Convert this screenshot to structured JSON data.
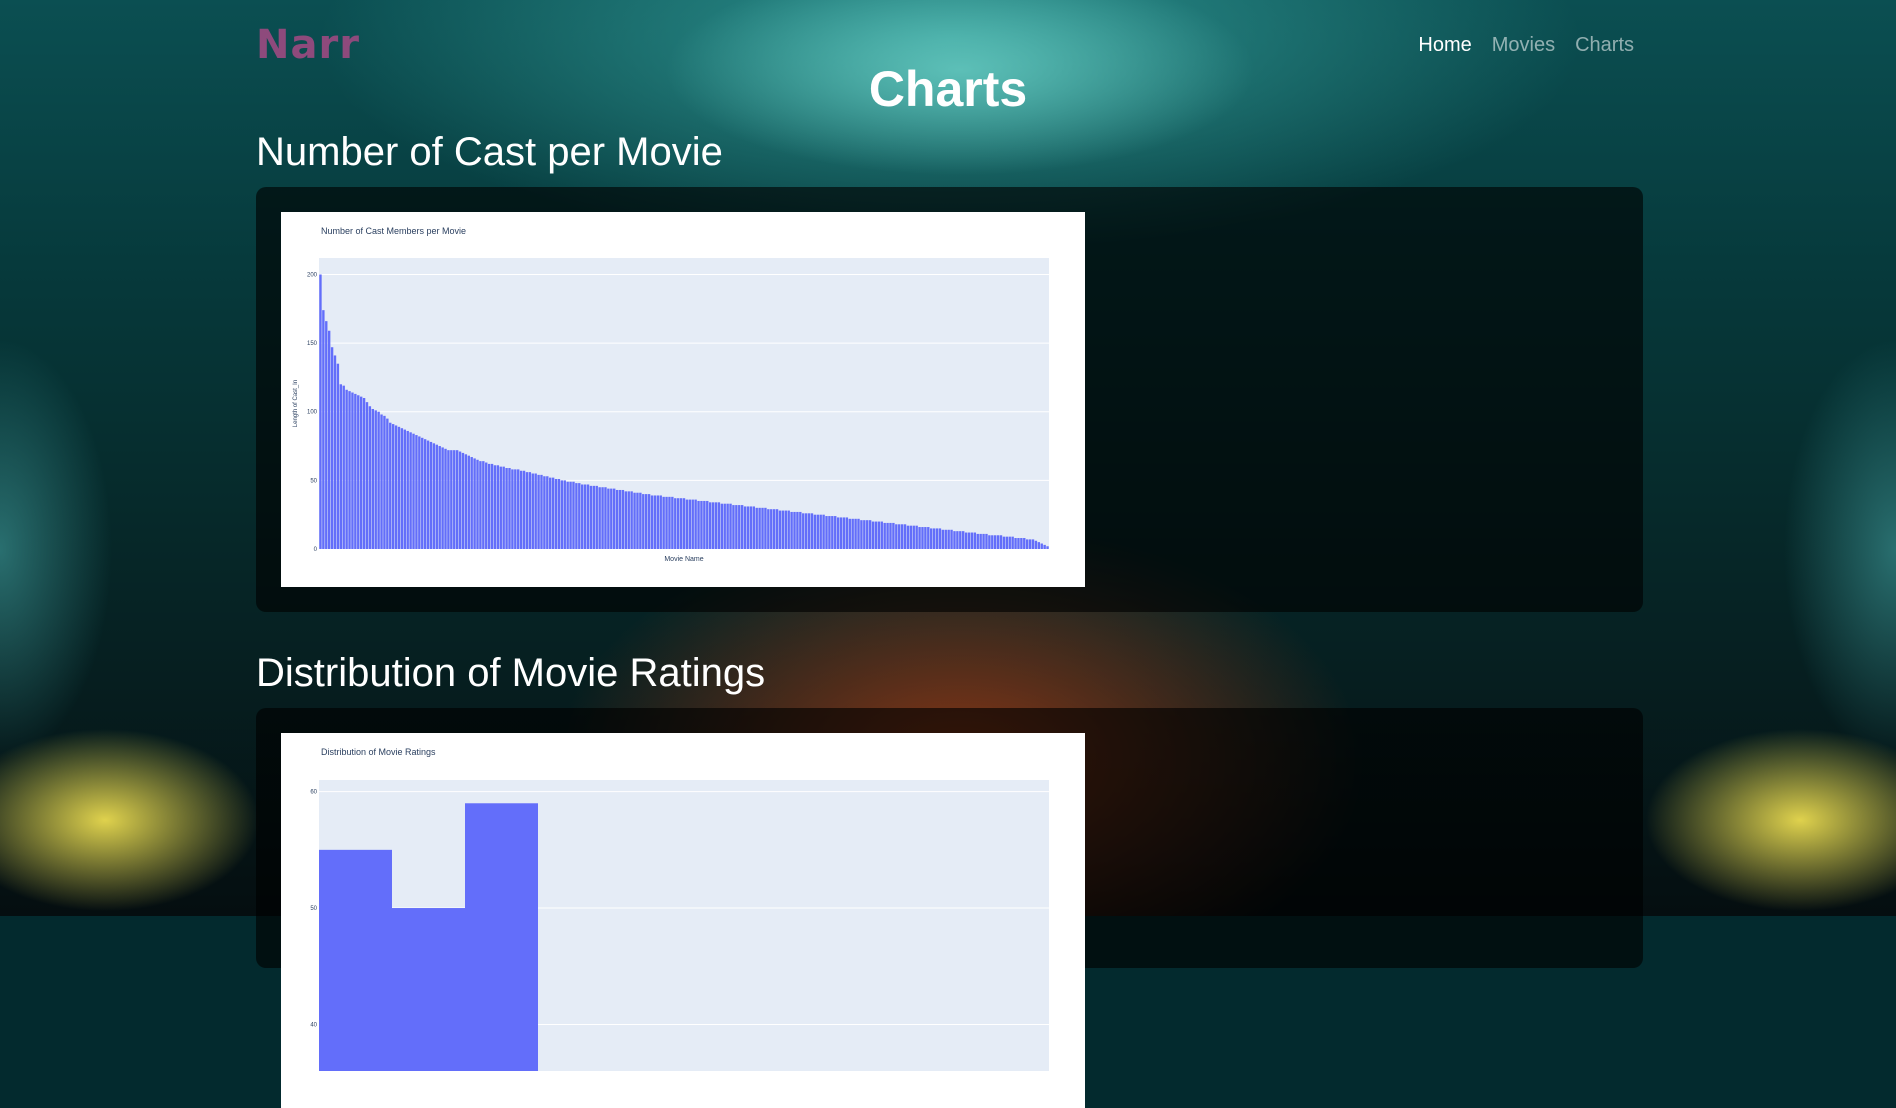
{
  "brand": "Narr",
  "nav": {
    "home": "Home",
    "movies": "Movies",
    "charts": "Charts"
  },
  "page_title": "Charts",
  "sections": [
    {
      "title": "Number of Cast per Movie"
    },
    {
      "title": "Distribution of Movie Ratings"
    }
  ],
  "colors": {
    "bar": "#636efa",
    "plot_bg": "#e5ecf6",
    "brand": "#8e4a7c"
  },
  "chart_data": [
    {
      "type": "bar",
      "title": "Number of Cast Members per Movie",
      "xlabel": "Movie Name",
      "ylabel": "Length of Cast_In",
      "ylim": [
        0,
        212
      ],
      "yticks": [
        0,
        50,
        100,
        150,
        200
      ],
      "values": [
        200,
        174,
        166,
        159,
        147,
        141,
        135,
        120,
        119,
        116,
        115,
        114,
        113,
        112,
        111,
        110,
        107,
        104,
        102,
        101,
        100,
        98,
        97,
        95,
        92,
        91,
        90,
        89,
        88,
        87,
        86,
        85,
        84,
        83,
        82,
        81,
        80,
        79,
        78,
        77,
        76,
        75,
        74,
        73,
        72,
        72,
        72,
        72,
        71,
        70,
        69,
        68,
        67,
        66,
        65,
        64,
        64,
        63,
        62,
        62,
        61,
        61,
        60,
        60,
        59,
        59,
        58,
        58,
        58,
        57,
        57,
        56,
        56,
        55,
        55,
        54,
        54,
        53,
        53,
        52,
        52,
        51,
        51,
        50,
        50,
        49,
        49,
        49,
        48,
        48,
        47,
        47,
        47,
        46,
        46,
        46,
        45,
        45,
        45,
        44,
        44,
        44,
        43,
        43,
        43,
        42,
        42,
        42,
        41,
        41,
        41,
        40,
        40,
        40,
        39,
        39,
        39,
        39,
        38,
        38,
        38,
        38,
        37,
        37,
        37,
        37,
        36,
        36,
        36,
        36,
        35,
        35,
        35,
        35,
        34,
        34,
        34,
        34,
        33,
        33,
        33,
        33,
        32,
        32,
        32,
        32,
        31,
        31,
        31,
        31,
        30,
        30,
        30,
        30,
        29,
        29,
        29,
        29,
        28,
        28,
        28,
        28,
        27,
        27,
        27,
        27,
        26,
        26,
        26,
        26,
        25,
        25,
        25,
        25,
        24,
        24,
        24,
        24,
        23,
        23,
        23,
        23,
        22,
        22,
        22,
        22,
        21,
        21,
        21,
        21,
        20,
        20,
        20,
        20,
        19,
        19,
        19,
        19,
        18,
        18,
        18,
        18,
        17,
        17,
        17,
        17,
        16,
        16,
        16,
        16,
        15,
        15,
        15,
        15,
        14,
        14,
        14,
        14,
        13,
        13,
        13,
        13,
        12,
        12,
        12,
        12,
        11,
        11,
        11,
        11,
        10,
        10,
        10,
        10,
        10,
        9,
        9,
        9,
        9,
        8,
        8,
        8,
        8,
        7,
        7,
        7,
        6,
        5,
        4,
        3,
        2
      ]
    },
    {
      "type": "bar",
      "title": "Distribution of Movie Ratings",
      "yticks": [
        40,
        50,
        60
      ],
      "ylim": [
        36,
        61
      ],
      "values": [
        55,
        50,
        59,
        0,
        0,
        0,
        0,
        0,
        0,
        0
      ]
    }
  ]
}
